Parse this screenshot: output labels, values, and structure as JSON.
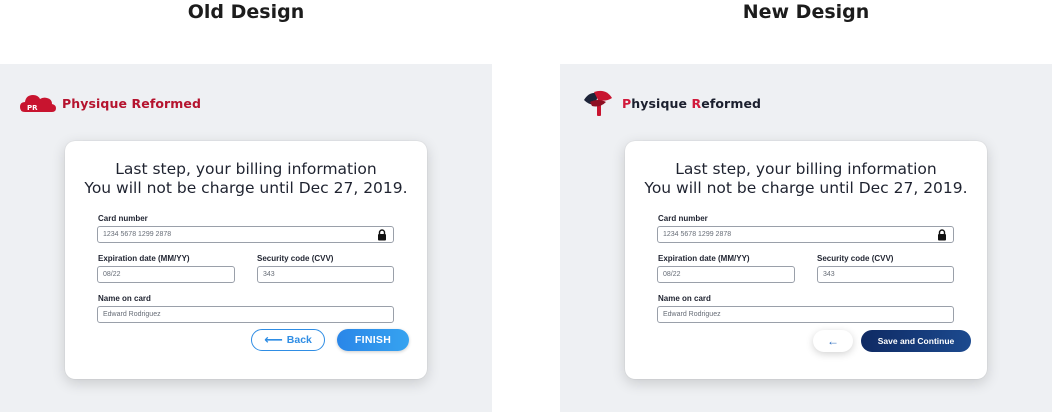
{
  "titles": {
    "old": "Old Design",
    "new": "New Design"
  },
  "brand": {
    "name": "Physique Reformed",
    "old_logo_text": "PR"
  },
  "form": {
    "heading_line1": "Last step, your billing information",
    "heading_line2": "You will not be charge until Dec 27, 2019.",
    "card_number_label": "Card number",
    "card_number_value": "1234 5678 1299 2878",
    "expiration_label": "Expiration date (MM/YY)",
    "expiration_value": "08/22",
    "security_label": "Security code (CVV)",
    "security_value": "343",
    "name_label": "Name on card",
    "name_value": "Edward Rodriguez"
  },
  "old_buttons": {
    "back_label": "Back",
    "finish_label": "FINISH"
  },
  "new_buttons": {
    "back_arrow": "←",
    "save_label": "Save and Continue"
  },
  "colors": {
    "old_brand": "#b5132e",
    "new_brand_accent": "#d1193a",
    "old_primary": "#2f8de4",
    "new_primary": "#0f2a63",
    "panel_bg": "#eef0f3"
  },
  "icons": [
    "cloud-logo-icon",
    "lock-icon",
    "arrow-left-icon",
    "leaf-logo-icon"
  ]
}
